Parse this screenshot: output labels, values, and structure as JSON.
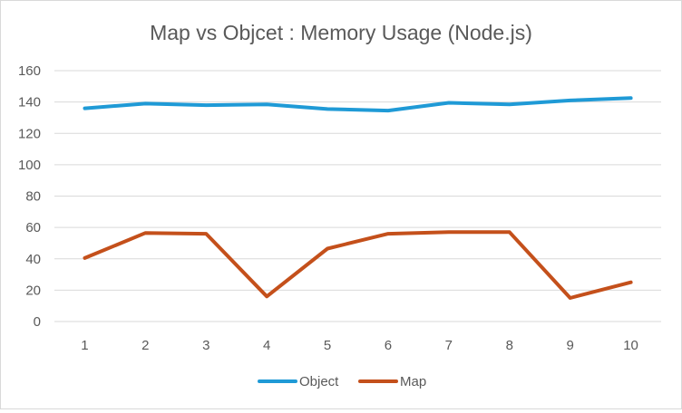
{
  "chart_data": {
    "type": "line",
    "title": "Map vs Objcet : Memory Usage (Node.js)",
    "xlabel": "",
    "ylabel": "",
    "categories": [
      "1",
      "2",
      "3",
      "4",
      "5",
      "6",
      "7",
      "8",
      "9",
      "10"
    ],
    "ylim": [
      0,
      160
    ],
    "yticks": [
      0,
      20,
      40,
      60,
      80,
      100,
      120,
      140,
      160
    ],
    "grid": true,
    "legend": "bottom",
    "series": [
      {
        "name": "Object",
        "color": "#1f9ad6",
        "values": [
          136,
          139,
          138,
          138.5,
          135.5,
          134.5,
          139.5,
          138.5,
          141,
          142.5
        ]
      },
      {
        "name": "Map",
        "color": "#c4501b",
        "values": [
          40.5,
          56.5,
          56,
          16,
          46.5,
          56,
          57,
          57,
          15,
          25
        ]
      }
    ]
  }
}
